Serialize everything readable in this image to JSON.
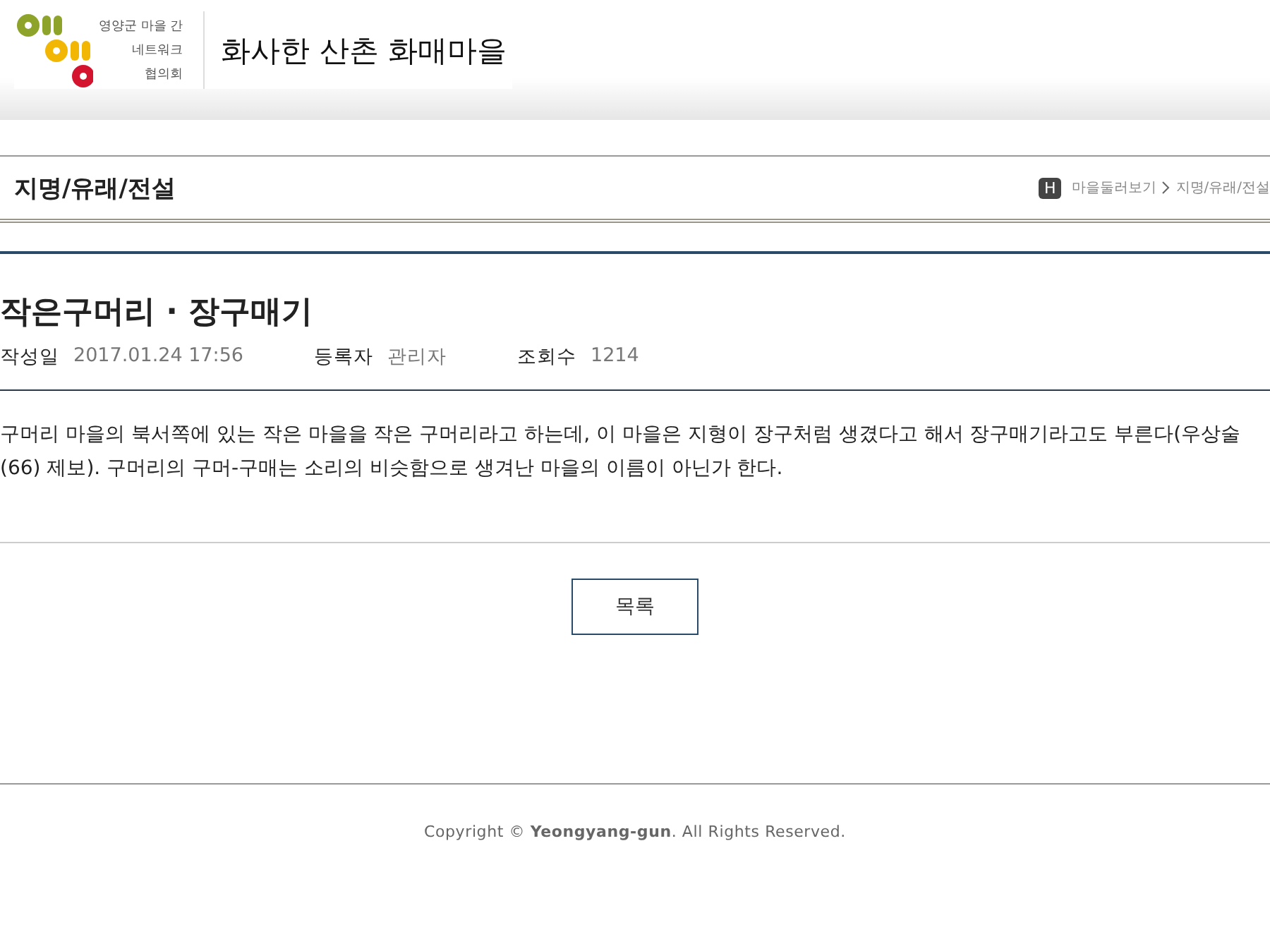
{
  "header": {
    "logo_lines": [
      "영양군 마을 간",
      "네트워크",
      "협의회"
    ],
    "site_title": "화사한 산촌 화매마을"
  },
  "page_bar": {
    "title": "지명/유래/전설",
    "home_badge": "H",
    "breadcrumb": [
      "마을둘러보기",
      "지명/유래/전설"
    ]
  },
  "post": {
    "title": "작은구머리 · 장구매기",
    "meta": [
      {
        "label": "작성일",
        "value": "2017.01.24 17:56"
      },
      {
        "label": "등록자",
        "value": "관리자"
      },
      {
        "label": "조회수",
        "value": "1214"
      }
    ],
    "body": "구머리 마을의 북서쪽에 있는 작은 마을을 작은 구머리라고 하는데, 이 마을은 지형이 장구처럼 생겼다고 해서 장구매기라고도 부른다(우상술(66) 제보). 구머리의 구머-구매는 소리의 비슷함으로 생겨난 마을의 이름이 아닌가 한다."
  },
  "list_button": "목록",
  "footer": "Copyright © **Yeongyang-gun**. All Rights Reserved."
}
